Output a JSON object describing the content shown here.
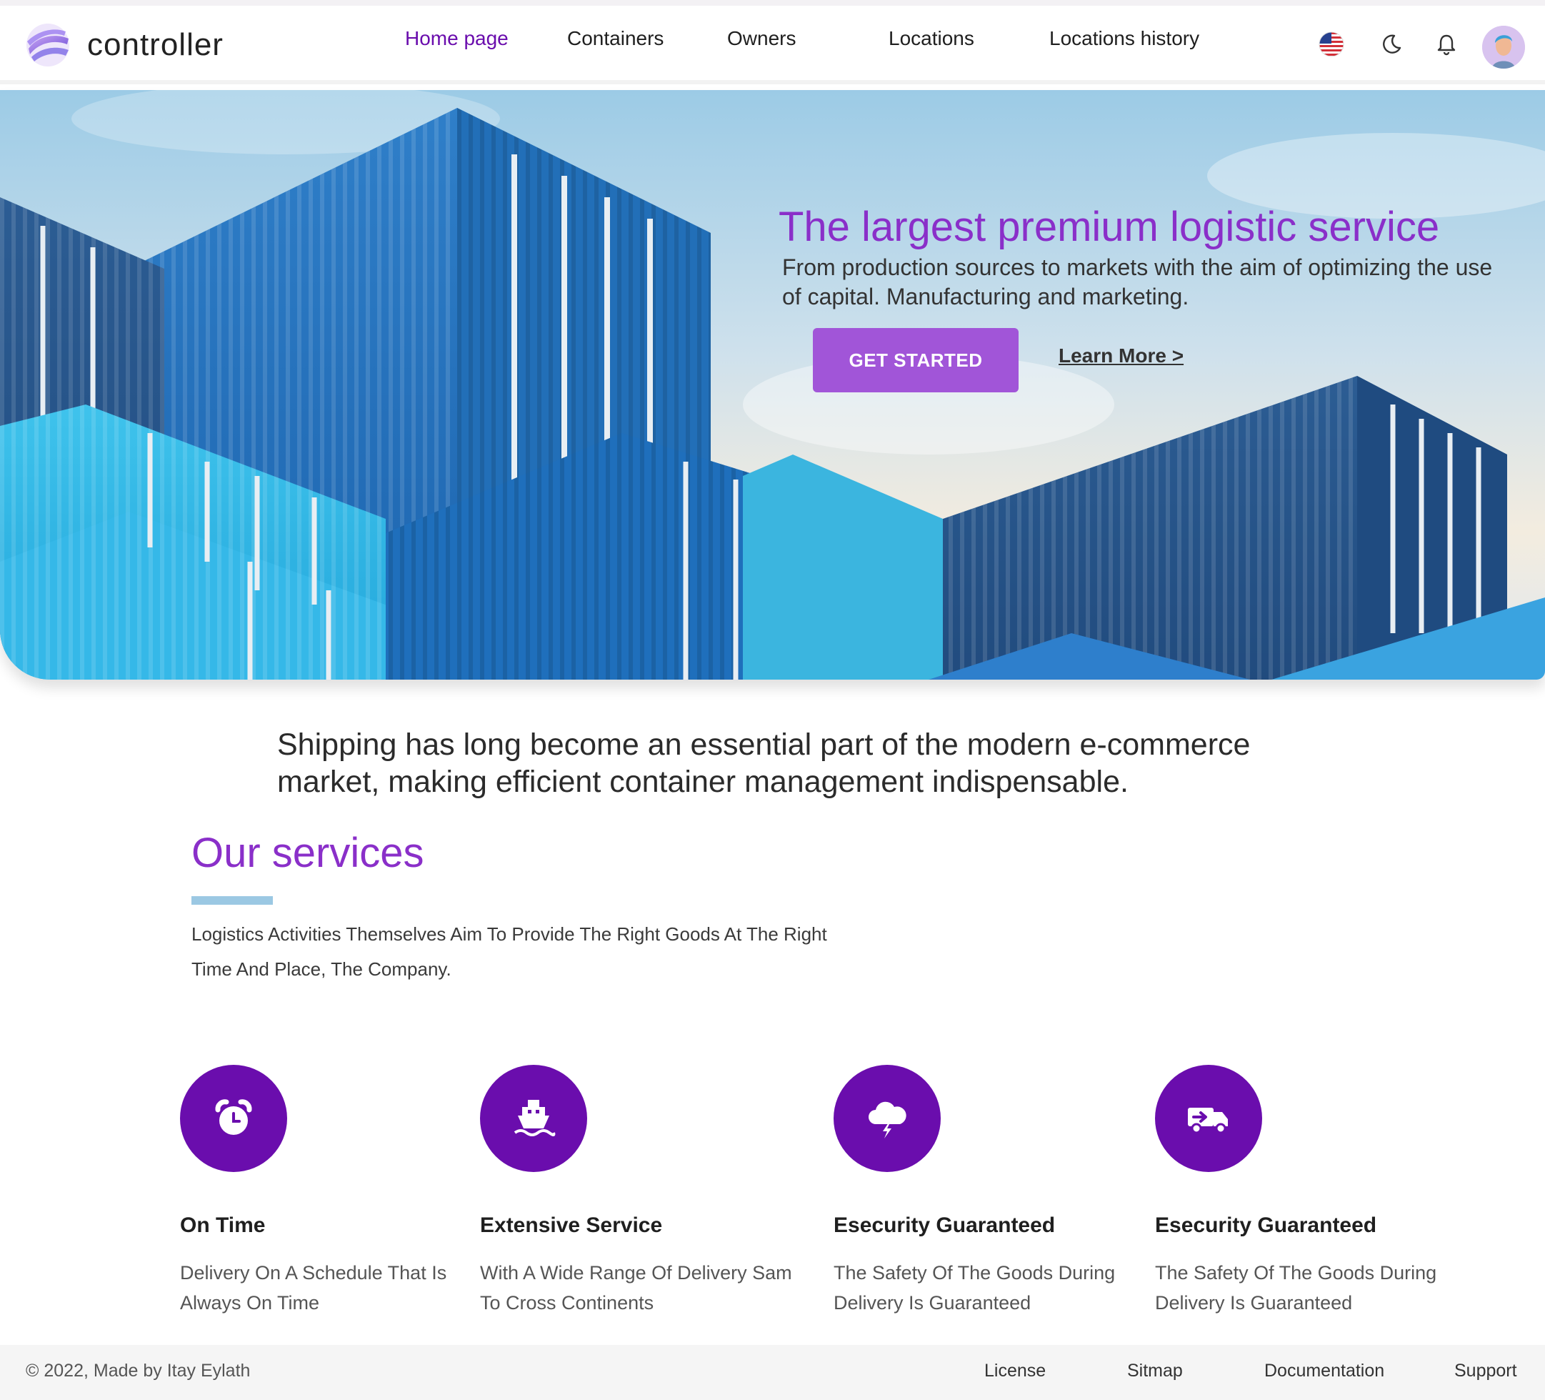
{
  "header": {
    "brand": "controller",
    "nav": [
      {
        "label": "Home page",
        "active": true
      },
      {
        "label": "Containers"
      },
      {
        "label": "Owners"
      },
      {
        "label": "Locations"
      },
      {
        "label": "Locations history"
      }
    ],
    "icons": [
      "us-flag-icon",
      "moon-icon",
      "bell-icon",
      "avatar"
    ]
  },
  "hero": {
    "title": "The largest premium logistic service",
    "subtitle": "From production sources to markets with the aim of optimizing the use of capital. Manufacturing and marketing.",
    "cta_label": "GET STARTED",
    "learn_more": "Learn More >"
  },
  "intro": "Shipping has long become an essential part of the modern e-commerce market, making efficient container management indispensable.",
  "services": {
    "title": "Our services",
    "description": "Logistics Activities Themselves Aim To Provide The Right Goods At The Right Time And Place, The Company.",
    "cards": [
      {
        "icon": "alarm-clock-icon",
        "title": "On Time",
        "text": "Delivery On A Schedule That Is Always On Time"
      },
      {
        "icon": "ship-icon",
        "title": "Extensive Service",
        "text": "With A Wide Range Of Delivery Sam To Cross Continents"
      },
      {
        "icon": "storm-cloud-icon",
        "title": "Esecurity Guaranteed",
        "text": "The Safety Of The Goods During Delivery Is Guaranteed"
      },
      {
        "icon": "delivery-truck-icon",
        "title": "Esecurity Guaranteed",
        "text": "The Safety Of The Goods During Delivery Is Guaranteed"
      }
    ]
  },
  "footer": {
    "copyright": "© 2022, Made by Itay Eylath",
    "links": [
      "License",
      "Sitmap",
      "Documentation",
      "Support"
    ]
  },
  "colors": {
    "accent": "#6a0dad",
    "accent_light": "#8a2fc9",
    "button": "#a155d8",
    "underline": "#9bc8e3"
  }
}
